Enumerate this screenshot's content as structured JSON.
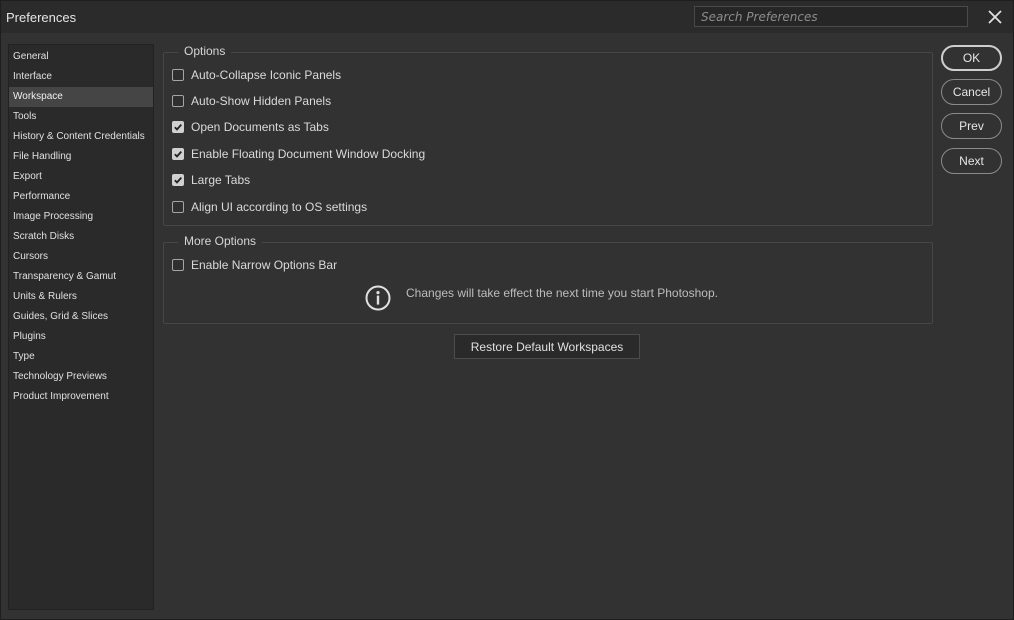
{
  "window": {
    "title": "Preferences"
  },
  "search": {
    "placeholder": "Search Preferences"
  },
  "sidebar": {
    "items": [
      {
        "label": "General",
        "selected": false
      },
      {
        "label": "Interface",
        "selected": false
      },
      {
        "label": "Workspace",
        "selected": true
      },
      {
        "label": "Tools",
        "selected": false
      },
      {
        "label": "History & Content Credentials",
        "selected": false
      },
      {
        "label": "File Handling",
        "selected": false
      },
      {
        "label": "Export",
        "selected": false
      },
      {
        "label": "Performance",
        "selected": false
      },
      {
        "label": "Image Processing",
        "selected": false
      },
      {
        "label": "Scratch Disks",
        "selected": false
      },
      {
        "label": "Cursors",
        "selected": false
      },
      {
        "label": "Transparency & Gamut",
        "selected": false
      },
      {
        "label": "Units & Rulers",
        "selected": false
      },
      {
        "label": "Guides, Grid & Slices",
        "selected": false
      },
      {
        "label": "Plugins",
        "selected": false
      },
      {
        "label": "Type",
        "selected": false
      },
      {
        "label": "Technology Previews",
        "selected": false
      },
      {
        "label": "Product Improvement",
        "selected": false
      }
    ]
  },
  "options": {
    "title": "Options",
    "items": [
      {
        "label": "Auto-Collapse Iconic Panels",
        "checked": false
      },
      {
        "label": "Auto-Show Hidden Panels",
        "checked": false
      },
      {
        "label": "Open Documents as Tabs",
        "checked": true
      },
      {
        "label": "Enable Floating Document Window Docking",
        "checked": true
      },
      {
        "label": "Large Tabs",
        "checked": true
      },
      {
        "label": "Align UI according to OS settings",
        "checked": false
      }
    ]
  },
  "more_options": {
    "title": "More Options",
    "items": [
      {
        "label": "Enable Narrow Options Bar",
        "checked": false
      }
    ],
    "info_text": "Changes will take effect the next time you start Photoshop.",
    "info_icon": "info-circle-icon"
  },
  "restore_label": "Restore Default Workspaces",
  "buttons": {
    "ok": "OK",
    "cancel": "Cancel",
    "prev": "Prev",
    "next": "Next"
  },
  "colors": {
    "background": "#323232",
    "sidebar": "#2a2a2a",
    "selected": "#454545",
    "text": "#d6d6d6"
  }
}
